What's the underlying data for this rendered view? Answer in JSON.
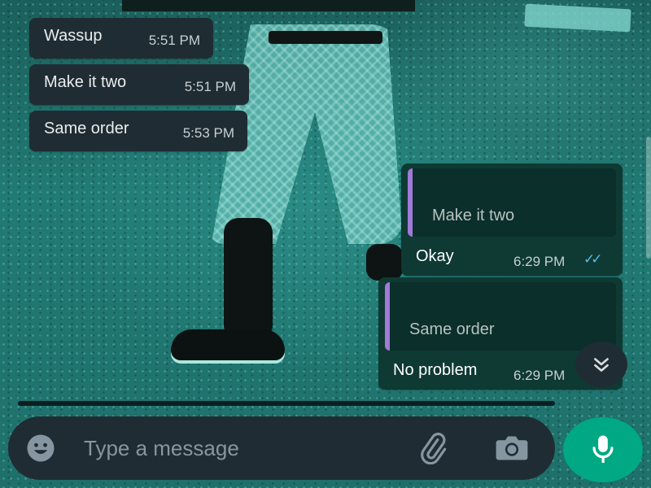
{
  "incoming_messages": [
    {
      "text": "Wassup",
      "time": "5:51 PM"
    },
    {
      "text": "Make it two",
      "time": "5:51 PM"
    },
    {
      "text": "Same order",
      "time": "5:53 PM"
    }
  ],
  "outgoing_messages": [
    {
      "quoted_text": "Make it two",
      "reply": "Okay",
      "time": "6:29 PM",
      "status_icon": "double-check-read-icon"
    },
    {
      "quoted_text": "Same order",
      "reply": "No problem",
      "time": "6:29 PM"
    }
  ],
  "scroll_down_icon": "double-chevron-down-icon",
  "composer": {
    "placeholder": "Type a message",
    "emoji_icon": "emoji-icon",
    "attach_icon": "paperclip-icon",
    "camera_icon": "camera-icon",
    "mic_icon": "microphone-icon"
  },
  "colors": {
    "bubble_in": "#202c33",
    "bubble_out": "#0e3a33",
    "quote_bar": "#a07ad6",
    "read_ticks": "#53bdeb",
    "mic_button": "#00a884"
  }
}
